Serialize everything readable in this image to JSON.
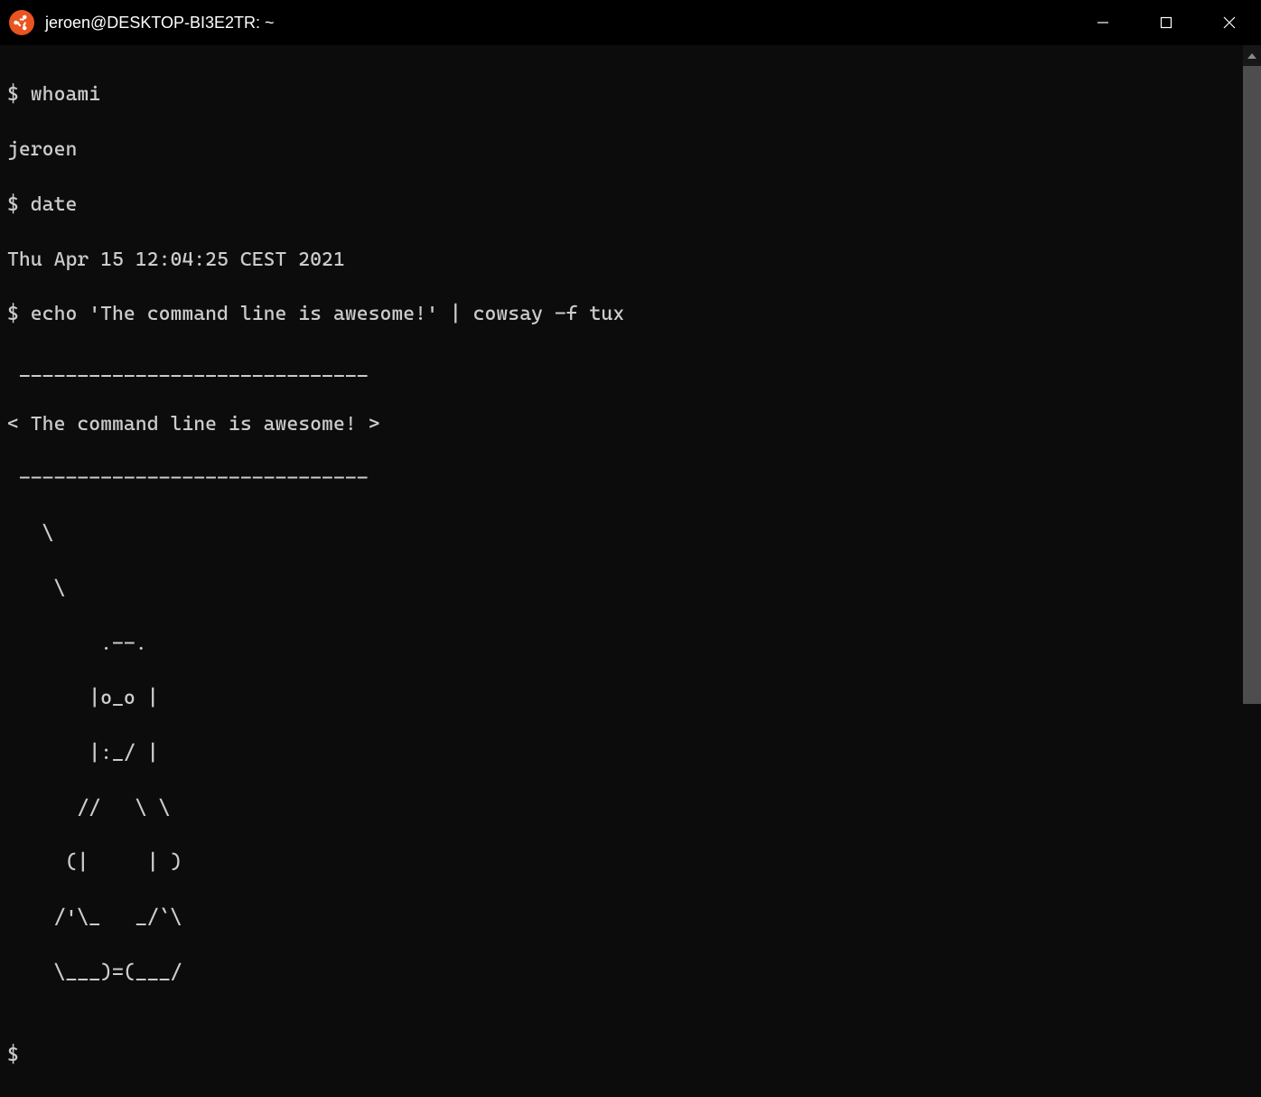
{
  "window": {
    "title": "jeroen@DESKTOP-BI3E2TR: ~"
  },
  "terminal": {
    "lines": [
      "$ whoami",
      "jeroen",
      "$ date",
      "Thu Apr 15 12:04:25 CEST 2021",
      "$ echo 'The command line is awesome!' | cowsay -f tux",
      " ______________________________",
      "< The command line is awesome! >",
      " ------------------------------",
      "   \\",
      "    \\",
      "        .--.",
      "       |o_o |",
      "       |:_/ |",
      "      //   \\ \\",
      "     (|     | )",
      "    /'\\_   _/`\\",
      "    \\___)=(___/",
      "",
      "$"
    ]
  }
}
